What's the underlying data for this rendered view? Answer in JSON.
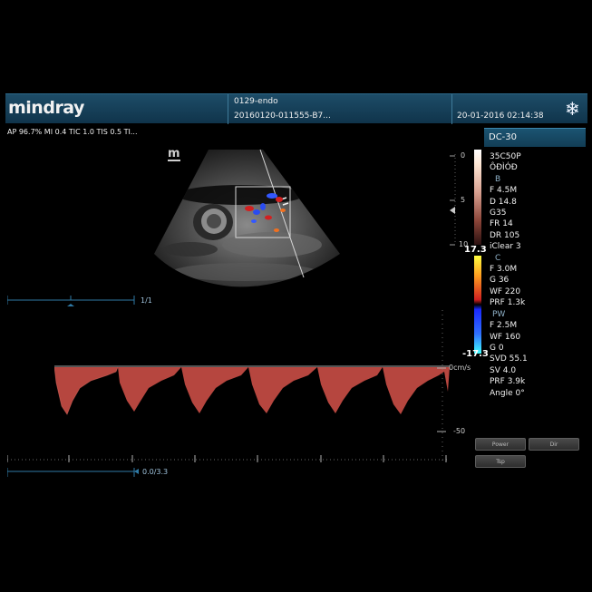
{
  "header": {
    "brand": "mindray",
    "patient_id": "0129-endo",
    "exam_id": "20160120-011555-B7...",
    "datetime": "20-01-2016 02:14:38",
    "freeze_icon": "snowflake-icon"
  },
  "top_params": "AP 96.7%  MI 0.4 TIC 1.0 TIS 0.5 TI...",
  "probe_mark": "m",
  "mode_panel": {
    "title": "DC-30",
    "probe": "35C50P",
    "preset": "ÔĐÌÓĐ",
    "b_header": "B",
    "b_params": [
      "F 4.5M",
      "D 14.8",
      "G35",
      "FR 14",
      "DR 105",
      "iClear 3"
    ],
    "c_header": "C",
    "c_params": [
      "F 3.0M",
      "G 36",
      "WF 220",
      "PRF 1.3k"
    ],
    "pw_header": "PW",
    "pw_params": [
      "F 2.5M",
      "WF 160",
      "G 0",
      "SVD 55.1",
      "SV 4.0",
      "PRF 3.9k",
      "Angle 0°"
    ]
  },
  "depth_scale": {
    "labels": [
      "0",
      "5",
      "10"
    ]
  },
  "color_bar": {
    "top_label": "17.3",
    "bottom_label": "-17.3"
  },
  "frame_counter": "1/1",
  "doppler_scale": {
    "baseline_label": "0cm/s",
    "lower_label": "-50"
  },
  "time_scale_label": "0.0/3.3",
  "buttons": [
    "Power",
    "Dir",
    "Tsp"
  ],
  "colors": {
    "header": "#14405a",
    "doppler": "#d0524a",
    "flow_red": "#d32020",
    "flow_blue": "#2a4cf0"
  }
}
